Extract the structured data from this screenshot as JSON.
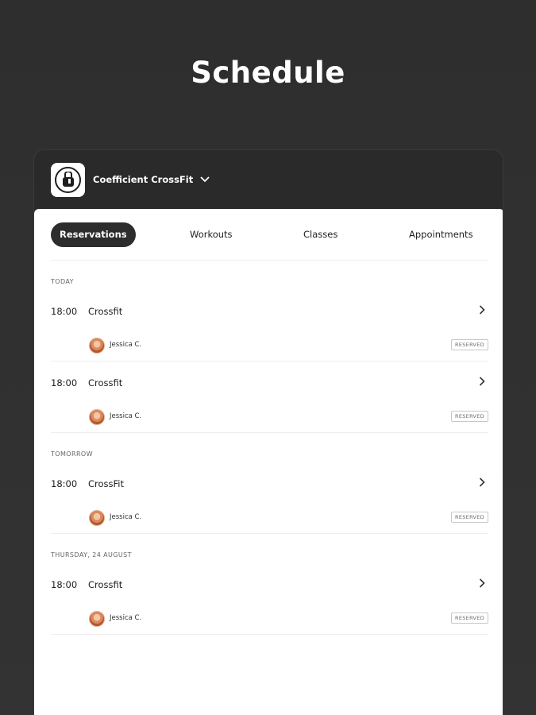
{
  "page_title": "Schedule",
  "header": {
    "gym_name": "Coefficient CrossFit"
  },
  "tabs": [
    {
      "label": "Reservations",
      "active": true
    },
    {
      "label": "Workouts",
      "active": false
    },
    {
      "label": "Classes",
      "active": false
    },
    {
      "label": "Appointments",
      "active": false
    }
  ],
  "sections": [
    {
      "label": "TODAY",
      "entries": [
        {
          "time": "18:00",
          "name": "Crossfit",
          "person": "Jessica C.",
          "status": "RESERVED"
        },
        {
          "time": "18:00",
          "name": "Crossfit",
          "person": "Jessica C.",
          "status": "RESERVED"
        }
      ]
    },
    {
      "label": "TOMORROW",
      "entries": [
        {
          "time": "18:00",
          "name": "CrossFit",
          "person": "Jessica C.",
          "status": "RESERVED"
        }
      ]
    },
    {
      "label": "THURSDAY, 24 AUGUST",
      "entries": [
        {
          "time": "18:00",
          "name": "Crossfit",
          "person": "Jessica C.",
          "status": "RESERVED"
        }
      ]
    }
  ]
}
